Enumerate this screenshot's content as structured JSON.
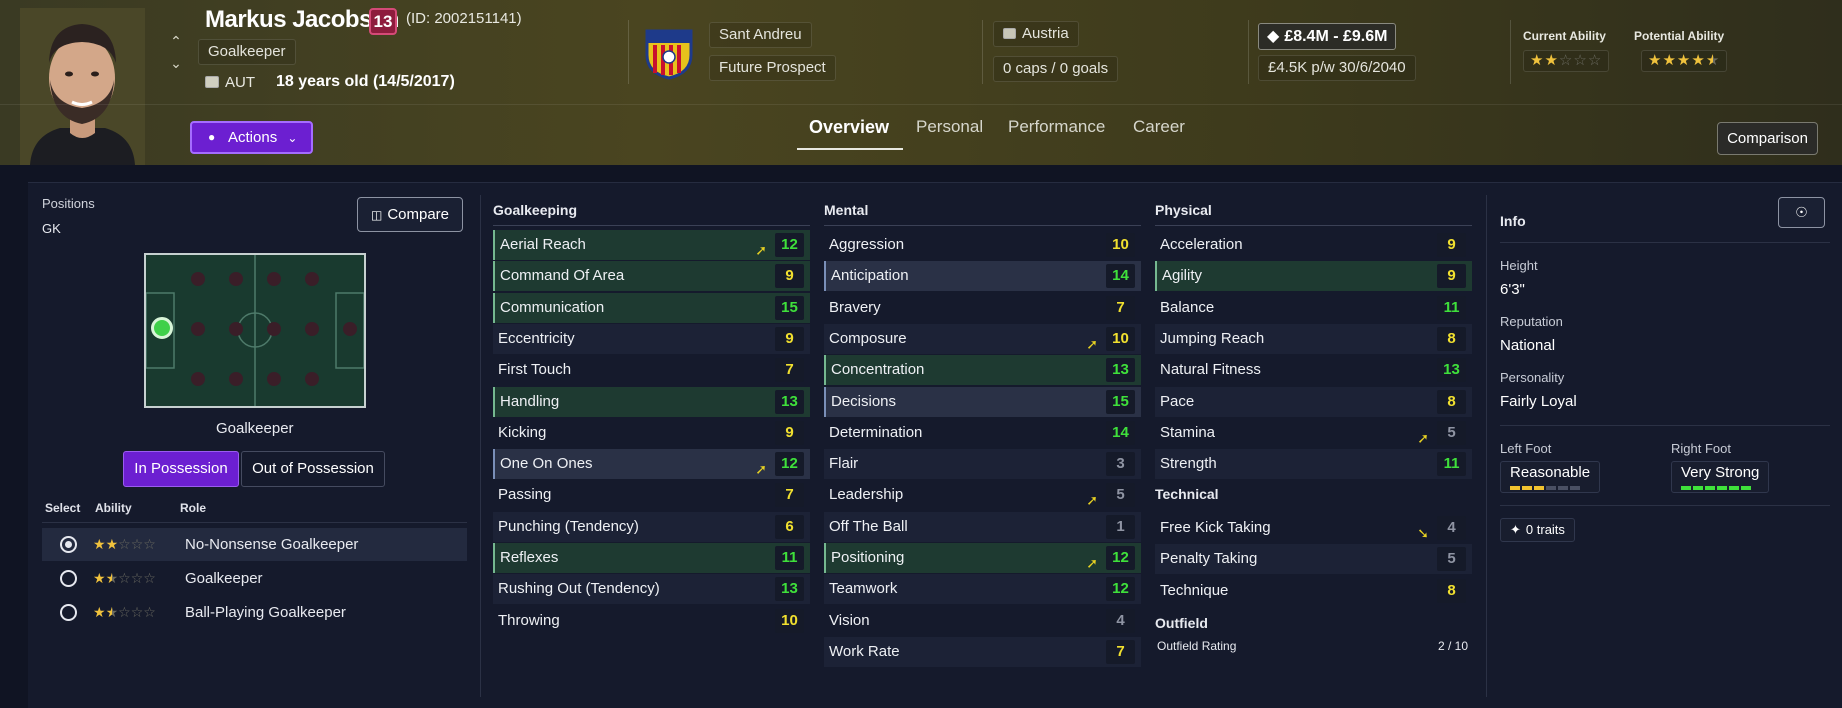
{
  "header": {
    "player_name": "Markus Jacobsen",
    "squad_number": "13",
    "player_id": "(ID: 2002151141)",
    "position": "Goalkeeper",
    "nationality_code": "AUT",
    "age": "18 years old (14/5/2017)",
    "club": "Sant Andreu",
    "status": "Future Prospect",
    "country": "Austria",
    "caps_goals": "0 caps / 0 goals",
    "value": "£8.4M - £9.6M",
    "contract": "£4.5K p/w 30/6/2040",
    "current_ability_label": "Current Ability",
    "potential_ability_label": "Potential Ability",
    "current_ability_stars": 2,
    "potential_ability_stars": 4.5,
    "actions_label": "Actions",
    "comparison_label": "Comparison",
    "tabs": [
      "Overview",
      "Personal",
      "Performance",
      "Career"
    ]
  },
  "positions_panel": {
    "title": "Positions",
    "current": "GK",
    "compare_label": "Compare",
    "pitch_caption": "Goalkeeper",
    "in_possession": "In Possession",
    "out_of_possession": "Out of Possession",
    "col_select": "Select",
    "col_ability": "Ability",
    "col_role": "Role",
    "roles": [
      {
        "name": "No-Nonsense Goalkeeper",
        "stars": 2,
        "selected": true
      },
      {
        "name": "Goalkeeper",
        "stars": 1.5,
        "selected": false
      },
      {
        "name": "Ball-Playing Goalkeeper",
        "stars": 1.5,
        "selected": false
      }
    ]
  },
  "goalkeeping": {
    "title": "Goalkeeping",
    "attrs": [
      {
        "name": "Aerial Reach",
        "value": "12",
        "hl": "green",
        "arrow": "up"
      },
      {
        "name": "Command Of Area",
        "value": "9",
        "hl": "green"
      },
      {
        "name": "Communication",
        "value": "15",
        "hl": "green"
      },
      {
        "name": "Eccentricity",
        "value": "9",
        "hl": "alt"
      },
      {
        "name": "First Touch",
        "value": "7",
        "hl": ""
      },
      {
        "name": "Handling",
        "value": "13",
        "hl": "green"
      },
      {
        "name": "Kicking",
        "value": "9",
        "hl": ""
      },
      {
        "name": "One On Ones",
        "value": "12",
        "hl": "blue",
        "arrow": "up"
      },
      {
        "name": "Passing",
        "value": "7",
        "hl": ""
      },
      {
        "name": "Punching (Tendency)",
        "value": "6",
        "hl": "alt"
      },
      {
        "name": "Reflexes",
        "value": "11",
        "hl": "green"
      },
      {
        "name": "Rushing Out (Tendency)",
        "value": "13",
        "hl": "alt"
      },
      {
        "name": "Throwing",
        "value": "10",
        "hl": ""
      }
    ]
  },
  "mental": {
    "title": "Mental",
    "attrs": [
      {
        "name": "Aggression",
        "value": "10",
        "hl": ""
      },
      {
        "name": "Anticipation",
        "value": "14",
        "hl": "blue"
      },
      {
        "name": "Bravery",
        "value": "7",
        "hl": ""
      },
      {
        "name": "Composure",
        "value": "10",
        "hl": "alt",
        "arrow": "up"
      },
      {
        "name": "Concentration",
        "value": "13",
        "hl": "green"
      },
      {
        "name": "Decisions",
        "value": "15",
        "hl": "blue"
      },
      {
        "name": "Determination",
        "value": "14",
        "hl": ""
      },
      {
        "name": "Flair",
        "value": "3",
        "hl": "alt"
      },
      {
        "name": "Leadership",
        "value": "5",
        "hl": "",
        "arrow": "up"
      },
      {
        "name": "Off The Ball",
        "value": "1",
        "hl": "alt"
      },
      {
        "name": "Positioning",
        "value": "12",
        "hl": "green",
        "arrow": "up"
      },
      {
        "name": "Teamwork",
        "value": "12",
        "hl": "alt"
      },
      {
        "name": "Vision",
        "value": "4",
        "hl": ""
      },
      {
        "name": "Work Rate",
        "value": "7",
        "hl": "alt"
      }
    ]
  },
  "physical": {
    "title": "Physical",
    "attrs": [
      {
        "name": "Acceleration",
        "value": "9",
        "hl": ""
      },
      {
        "name": "Agility",
        "value": "9",
        "hl": "green"
      },
      {
        "name": "Balance",
        "value": "11",
        "hl": ""
      },
      {
        "name": "Jumping Reach",
        "value": "8",
        "hl": "alt"
      },
      {
        "name": "Natural Fitness",
        "value": "13",
        "hl": ""
      },
      {
        "name": "Pace",
        "value": "8",
        "hl": "alt"
      },
      {
        "name": "Stamina",
        "value": "5",
        "hl": "",
        "arrow": "up"
      },
      {
        "name": "Strength",
        "value": "11",
        "hl": "alt"
      }
    ]
  },
  "technical": {
    "title": "Technical",
    "attrs": [
      {
        "name": "Free Kick Taking",
        "value": "4",
        "hl": "",
        "arrow": "down"
      },
      {
        "name": "Penalty Taking",
        "value": "5",
        "hl": "alt"
      },
      {
        "name": "Technique",
        "value": "8",
        "hl": ""
      }
    ]
  },
  "outfield": {
    "title": "Outfield",
    "rating_label": "Outfield Rating",
    "rating_value": "2 / 10"
  },
  "info": {
    "title": "Info",
    "height_label": "Height",
    "height": "6'3\"",
    "reputation_label": "Reputation",
    "reputation": "National",
    "personality_label": "Personality",
    "personality": "Fairly Loyal",
    "left_foot_label": "Left Foot",
    "left_foot": "Reasonable",
    "left_foot_level": 3,
    "right_foot_label": "Right Foot",
    "right_foot": "Very Strong",
    "right_foot_level": 6,
    "traits": "0 traits"
  },
  "colors": {
    "green_value": "#3fe03b",
    "yellow_value": "#f1e02f",
    "grey_value": "#8f94a3",
    "accent_purple": "#6c1fd1",
    "star": "#f0c23d"
  }
}
